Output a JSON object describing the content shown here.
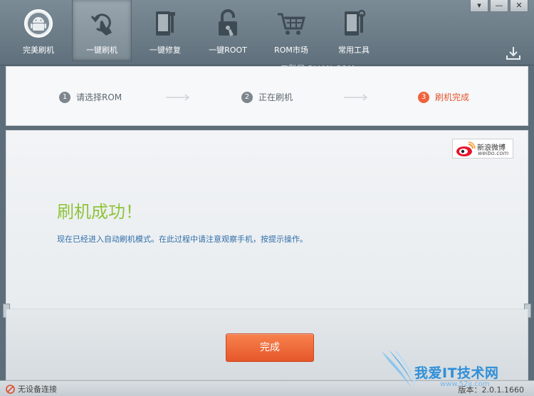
{
  "window": {
    "dropdown_glyph": "▾",
    "minimize_glyph": "—",
    "close_glyph": "✕"
  },
  "nav": {
    "items": [
      {
        "label": "完美刷机",
        "icon": "android-icon"
      },
      {
        "label": "一键刷机",
        "icon": "flash-tap-icon"
      },
      {
        "label": "一键修复",
        "icon": "phone-repair-icon"
      },
      {
        "label": "一键ROOT",
        "icon": "unlock-icon"
      },
      {
        "label": "ROM市场",
        "icon": "cart-icon"
      },
      {
        "label": "常用工具",
        "icon": "tools-icon"
      }
    ],
    "active_index": 1
  },
  "watermark_top": "三联网 3LIAN.COM",
  "steps": [
    {
      "num": "1",
      "label": "请选择ROM"
    },
    {
      "num": "2",
      "label": "正在刷机"
    },
    {
      "num": "3",
      "label": "刷机完成"
    }
  ],
  "weibo": {
    "cn": "新浪微博",
    "en": "weibo.com"
  },
  "result": {
    "title": "刷机成功！",
    "desc": "现在已经进入自动刷机模式。在此过程中请注意观察手机，按提示操作。"
  },
  "finish_label": "完成",
  "status": {
    "left": "无设备连接",
    "version": "版本：2.0.1.1660"
  },
  "site_watermark": {
    "cn": "我爱IT技术网",
    "url": "www.52ij.com"
  },
  "colors": {
    "accent": "#f0623b",
    "success": "#90c43c",
    "link": "#2f6ea8"
  }
}
